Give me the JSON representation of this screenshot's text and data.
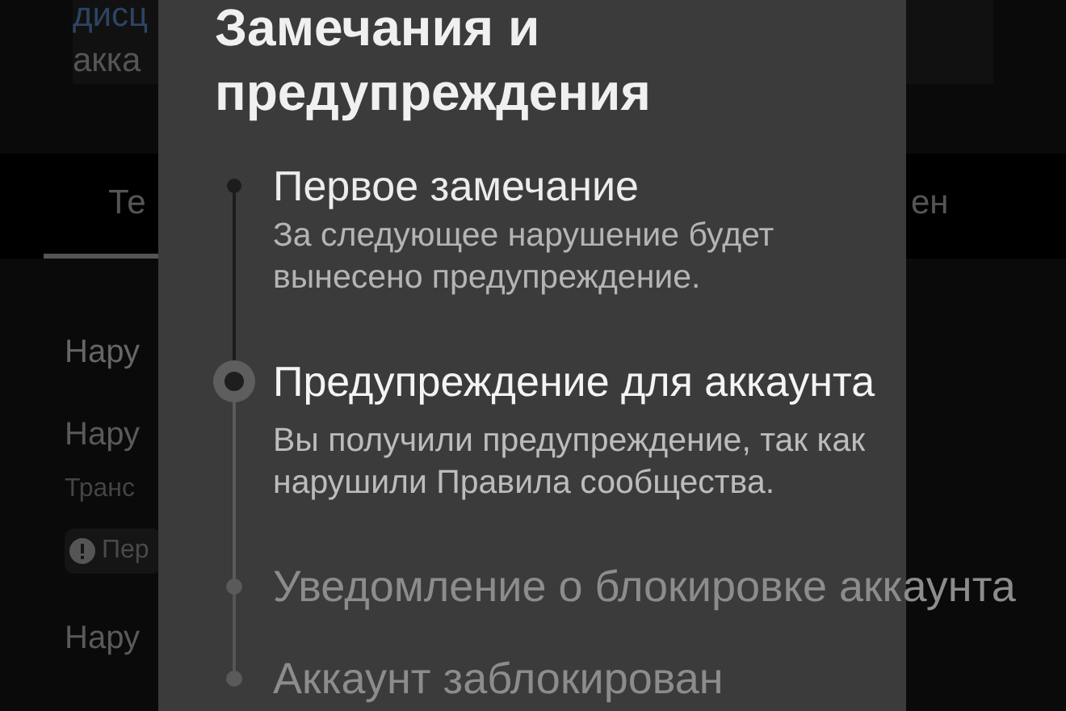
{
  "background": {
    "card": {
      "line_1": "дисц",
      "line_2": "акка"
    },
    "tabs": [
      {
        "label": "Те",
        "selected": true
      },
      {
        "label": "ен",
        "selected": false
      }
    ],
    "section_title": "Нару",
    "items": [
      {
        "title": "Нару",
        "subtitle": "Транс",
        "badge": "Пер"
      },
      {
        "title": "Нару"
      }
    ]
  },
  "dialog": {
    "title": "Замечания и предупреждения",
    "steps": [
      {
        "title": "Первое замечание",
        "description": "За следующее нарушение будет вынесено предупреждение.",
        "kind": "done"
      },
      {
        "title": "Предупреждение для аккаунта",
        "description": "Вы получили предупреждение, так как нарушили Правила сообщества.",
        "kind": "current"
      },
      {
        "title": "Уведомление о блокировке аккаунта",
        "kind": "upcoming"
      },
      {
        "title": "Аккаунт заблокирован",
        "kind": "upcoming"
      }
    ]
  }
}
